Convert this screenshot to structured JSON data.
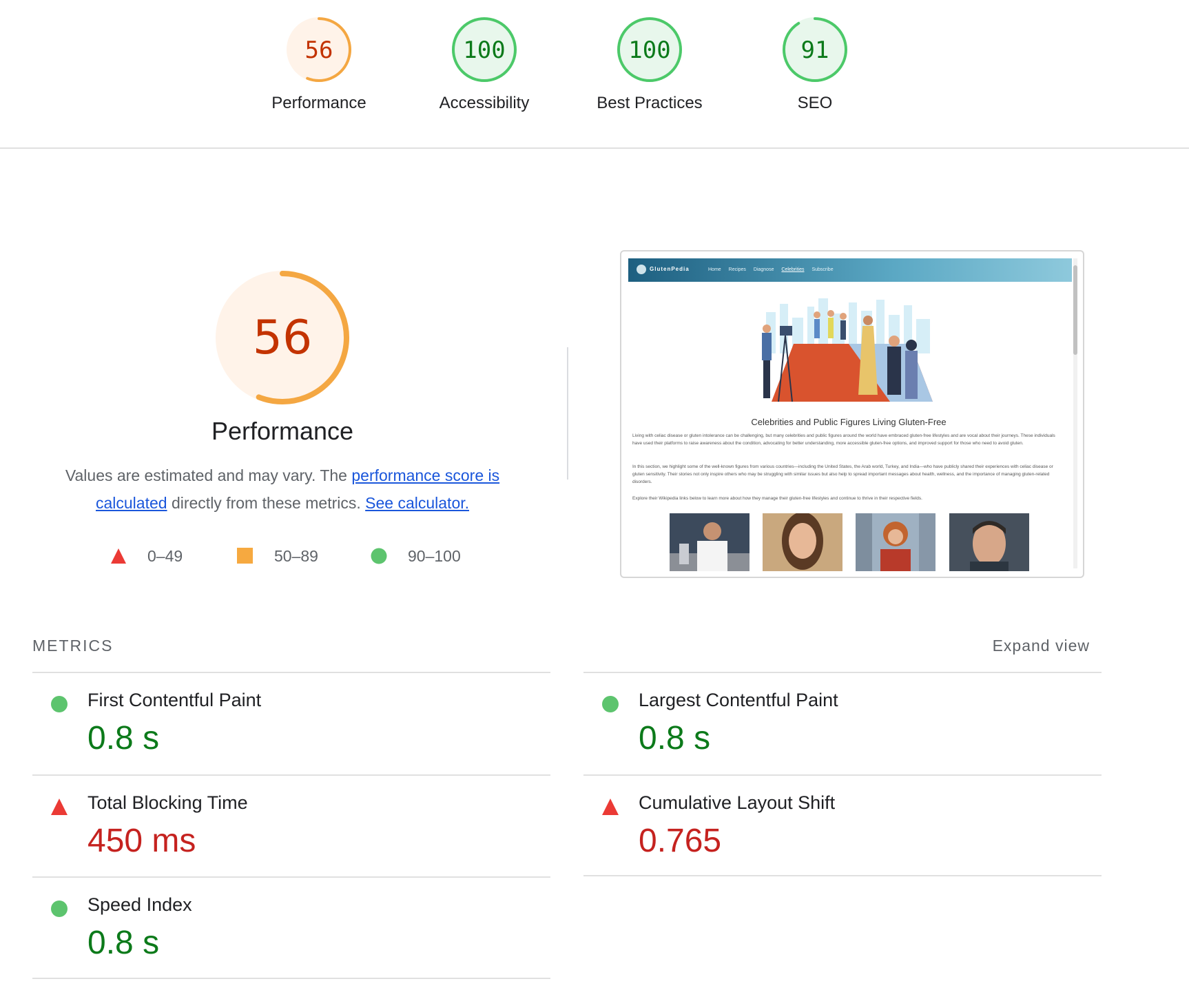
{
  "header": {
    "gauges": [
      {
        "label": "Performance",
        "score": "56",
        "fraction": 0.56,
        "status": "average"
      },
      {
        "label": "Accessibility",
        "score": "100",
        "fraction": 1.0,
        "status": "good"
      },
      {
        "label": "Best Practices",
        "score": "100",
        "fraction": 1.0,
        "status": "good"
      },
      {
        "label": "SEO",
        "score": "91",
        "fraction": 0.91,
        "status": "good"
      }
    ]
  },
  "performance": {
    "score": "56",
    "fraction": 0.56,
    "title": "Performance",
    "desc_prefix": "Values are estimated and may vary. The ",
    "link_score": "performance score is calculated",
    "desc_middle": " directly from these metrics. ",
    "link_calculator": "See calculator.",
    "legend": [
      {
        "icon": "triangle-icon",
        "range": "0–49"
      },
      {
        "icon": "square-icon",
        "range": "50–89"
      },
      {
        "icon": "circle-icon",
        "range": "90–100"
      }
    ]
  },
  "screenshot": {
    "site_logo": "GlutenPedia",
    "nav_links": [
      "Home",
      "Recipes",
      "Diagnose",
      "Celebrities",
      "Subscribe"
    ],
    "heading": "Celebrities and Public Figures Living Gluten-Free",
    "paragraphs": [
      "Living with celiac disease or gluten intolerance can be challenging, but many celebrities and public figures around the world have embraced gluten-free lifestyles and are vocal about their journeys. These individuals have used their platforms to raise awareness about the condition, advocating for better understanding, more accessible gluten-free options, and improved support for those who need to avoid gluten.",
      "In this section, we highlight some of the well-known figures from various countries—including the United States, the Arab world, Turkey, and India—who have publicly shared their experiences with celiac disease or gluten sensitivity. Their stories not only inspire others who may be struggling with similar issues but also help to spread important messages about health, wellness, and the importance of managing gluten-related disorders.",
      "Explore their Wikipedia links below to learn more about how they manage their gluten-free lifestyles and continue to thrive in their respective fields."
    ]
  },
  "metrics": {
    "label": "METRICS",
    "expand": "Expand view",
    "items": [
      {
        "title": "First Contentful Paint",
        "value": "0.8 s",
        "status": "good"
      },
      {
        "title": "Largest Contentful Paint",
        "value": "0.8 s",
        "status": "good"
      },
      {
        "title": "Total Blocking Time",
        "value": "450 ms",
        "status": "bad"
      },
      {
        "title": "Cumulative Layout Shift",
        "value": "0.765",
        "status": "bad"
      },
      {
        "title": "Speed Index",
        "value": "0.8 s",
        "status": "good"
      }
    ]
  },
  "colors": {
    "good": "#0cce6b",
    "good_text": "#0c7a1a",
    "average": "#ffa400",
    "average_text": "#c33300",
    "bad": "#ff4e42",
    "bad_text": "#c5221f"
  }
}
